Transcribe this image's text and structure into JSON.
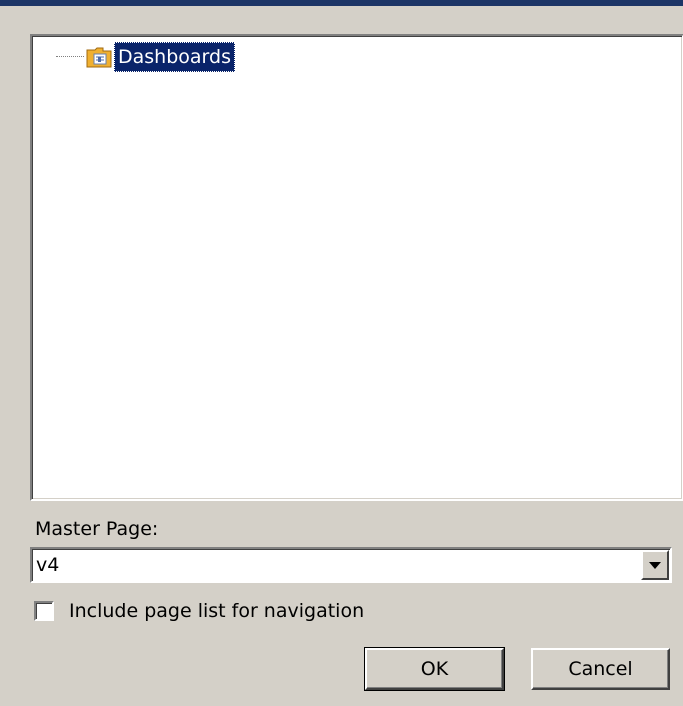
{
  "tree": {
    "items": [
      {
        "label": "Dashboards",
        "icon": "folder-icon",
        "selected": true
      }
    ]
  },
  "master_page": {
    "label": "Master Page:",
    "value": "v4"
  },
  "navigation": {
    "checkbox_label": "Include page list for navigation",
    "checked": false
  },
  "buttons": {
    "ok_label": "OK",
    "cancel_label": "Cancel"
  },
  "colors": {
    "dialog_bg": "#d4d0c8",
    "selection": "#0a246a",
    "folder": "#f0b030"
  }
}
